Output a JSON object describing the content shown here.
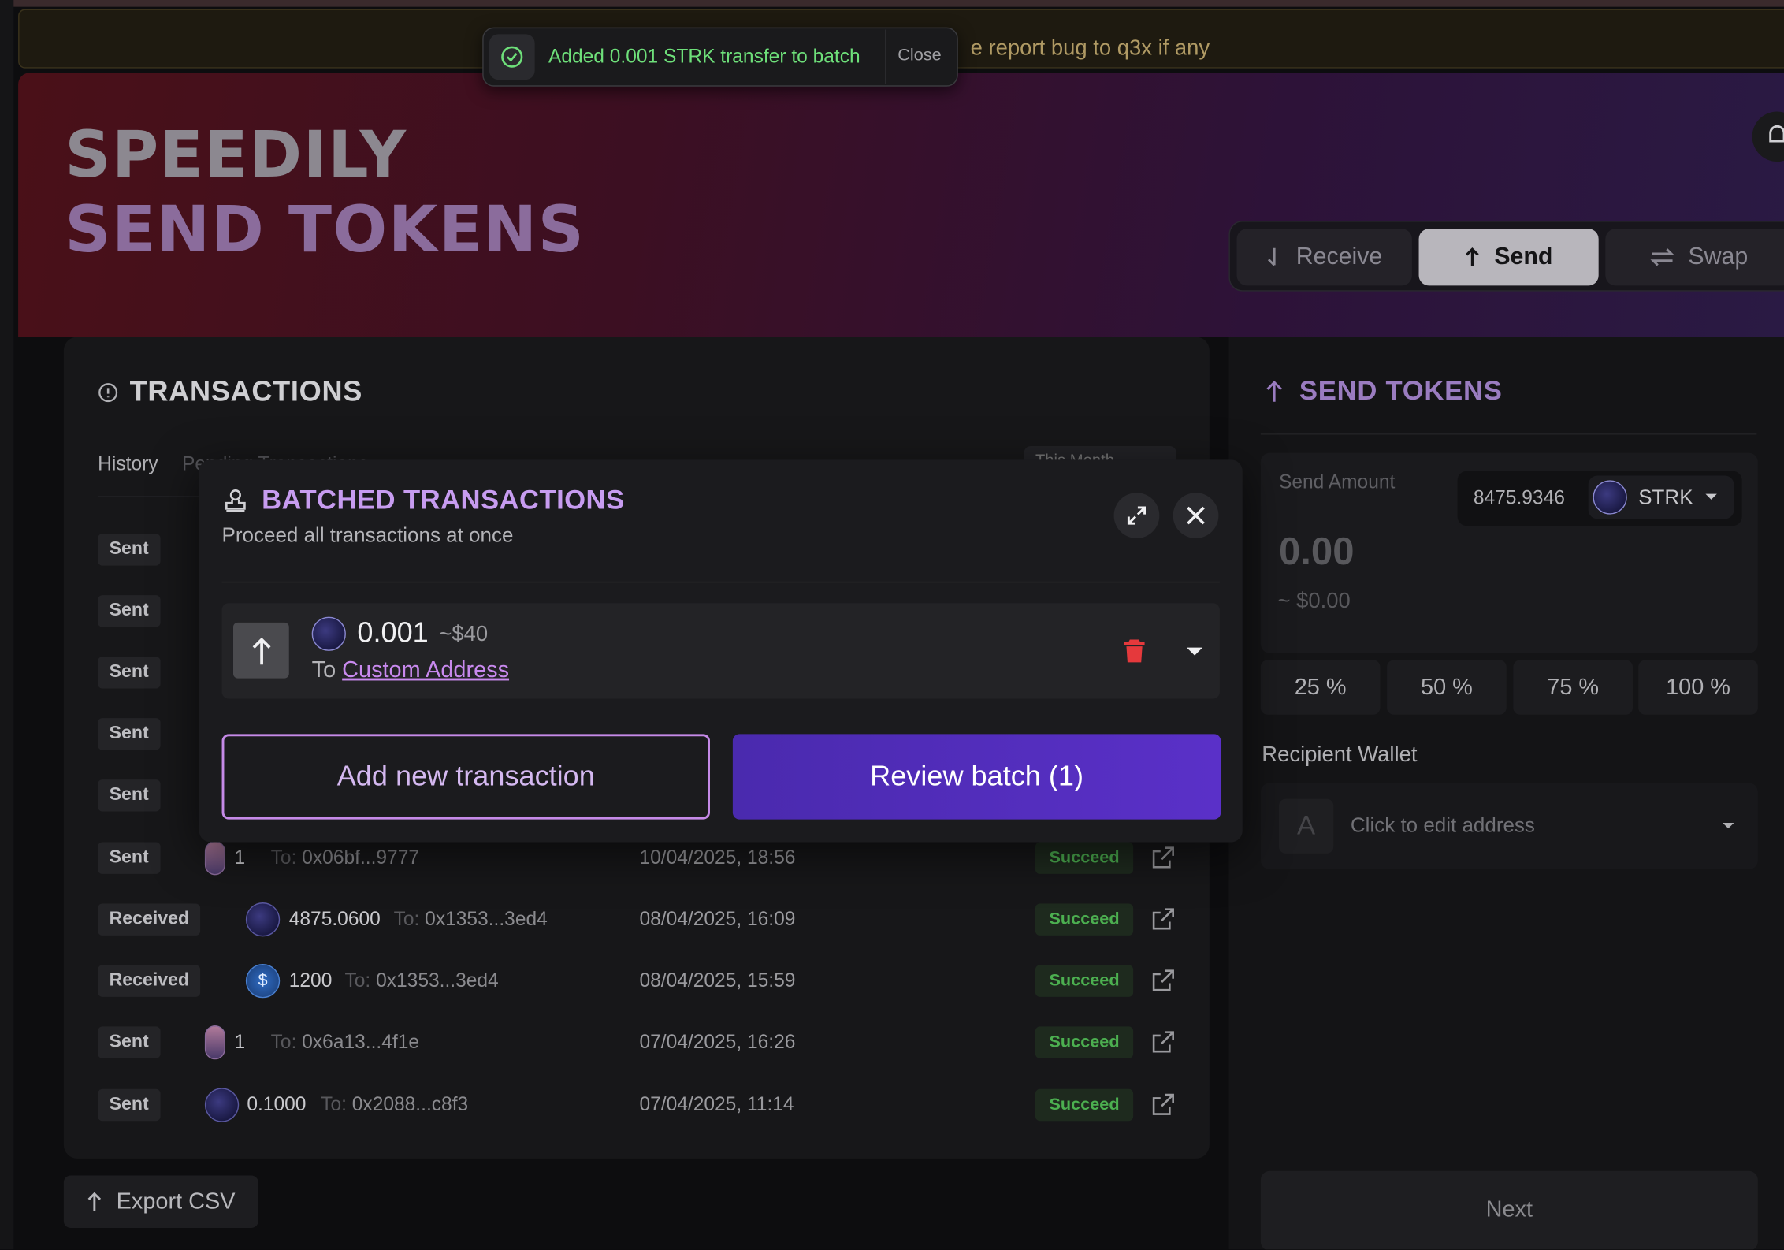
{
  "banner": {
    "text": "e report bug to q3x if any"
  },
  "toast": {
    "message": "Added 0.001 STRK transfer to batch",
    "close_label": "Close"
  },
  "hero": {
    "line1": "SPEEDILY",
    "line2": "SEND TOKENS"
  },
  "modes": {
    "receive": "Receive",
    "send": "Send",
    "swap": "Swap",
    "active": "Send"
  },
  "transactions": {
    "title": "TRANSACTIONS",
    "tab_history": "History",
    "tab_pending": "Pending Transactions",
    "filter": "This Month",
    "rows": [
      {
        "type": "Sent"
      },
      {
        "type": "Sent"
      },
      {
        "type": "Sent"
      },
      {
        "type": "Sent"
      },
      {
        "type": "Sent"
      },
      {
        "type": "Sent",
        "token": "nft",
        "amount": "1",
        "to_label": "To:",
        "to": "0x06bf...9777",
        "date": "10/04/2025, 18:56",
        "status": "Succeed"
      },
      {
        "type": "Received",
        "token": "strk",
        "amount": "4875.0600",
        "to_label": "To:",
        "to": "0x1353...3ed4",
        "date": "08/04/2025, 16:09",
        "status": "Succeed"
      },
      {
        "type": "Received",
        "token": "usdc",
        "amount": "1200",
        "to_label": "To:",
        "to": "0x1353...3ed4",
        "date": "08/04/2025, 15:59",
        "status": "Succeed"
      },
      {
        "type": "Sent",
        "token": "nft",
        "amount": "1",
        "to_label": "To:",
        "to": "0x6a13...4f1e",
        "date": "07/04/2025, 16:26",
        "status": "Succeed"
      },
      {
        "type": "Sent",
        "token": "strk",
        "amount": "0.1000",
        "to_label": "To:",
        "to": "0x2088...c8f3",
        "date": "07/04/2025, 11:14",
        "status": "Succeed"
      }
    ],
    "export_label": "Export CSV"
  },
  "send": {
    "title": "SEND TOKENS",
    "amount_label": "Send Amount",
    "balance": "8475.9346",
    "token": "STRK",
    "amount_value": "0.00",
    "usd_value": "~ $0.00",
    "percents": [
      "25 %",
      "50 %",
      "75 %",
      "100 %"
    ],
    "recipient_label": "Recipient Wallet",
    "recipient_avatar": "A",
    "recipient_placeholder": "Click to edit address",
    "next_label": "Next"
  },
  "batch": {
    "title": "BATCHED TRANSACTIONS",
    "subtitle": "Proceed all transactions at once",
    "item": {
      "amount": "0.001",
      "usd": "~$40",
      "to_prefix": "To",
      "to_link": "Custom Address"
    },
    "add_label": "Add new transaction",
    "review_label": "Review batch (1)"
  },
  "colors": {
    "accent_purple": "#c889ee",
    "review_button": "#5030c0",
    "success_green": "#4caf50",
    "danger_red": "#e5393c"
  }
}
